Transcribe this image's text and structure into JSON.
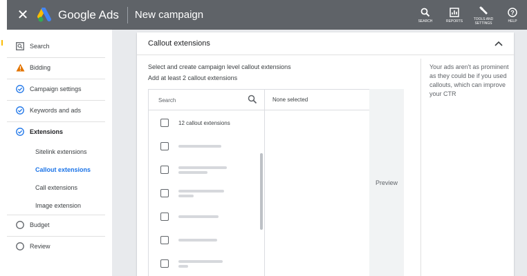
{
  "topbar": {
    "brand": "Google Ads",
    "page_title": "New campaign",
    "actions": [
      {
        "label": "SEARCH",
        "icon": "search-icon"
      },
      {
        "label": "REPORTS",
        "icon": "reports-icon"
      },
      {
        "label": "TOOLS AND SETTINGS",
        "icon": "wrench-icon"
      },
      {
        "label": "HELP",
        "icon": "help-icon"
      }
    ]
  },
  "sidebar": {
    "items": [
      {
        "label": "Search",
        "icon": "search-network-icon"
      },
      {
        "label": "Bidding",
        "icon": "warning-icon"
      },
      {
        "label": "Campaign settings",
        "icon": "check-circle-icon"
      },
      {
        "label": "Keywords and ads",
        "icon": "check-circle-icon"
      },
      {
        "label": "Extensions",
        "icon": "check-circle-icon"
      },
      {
        "label": "Budget",
        "icon": "empty-circle-icon"
      },
      {
        "label": "Review",
        "icon": "empty-circle-icon"
      }
    ],
    "subitems": [
      {
        "label": "Sitelink extensions"
      },
      {
        "label": "Callout extensions"
      },
      {
        "label": "Call extensions"
      },
      {
        "label": "Image extension"
      }
    ]
  },
  "panel": {
    "title": "Callout extensions",
    "instruction_1": "Select and create campaign level callout extensions",
    "instruction_2": "Add at least 2 callout extensions",
    "search_placeholder": "Search",
    "none_selected": "None selected",
    "select_all_label": "12 callout extensions",
    "preview_label": "Preview",
    "side_note": "Your ads aren't as prominent as they could be if you used callouts, which can improve your CTR"
  },
  "colors": {
    "topbar": "#5f6368",
    "accent_blue": "#1a73e8",
    "warning": "#f29900",
    "main_bg": "#e8eaed"
  }
}
